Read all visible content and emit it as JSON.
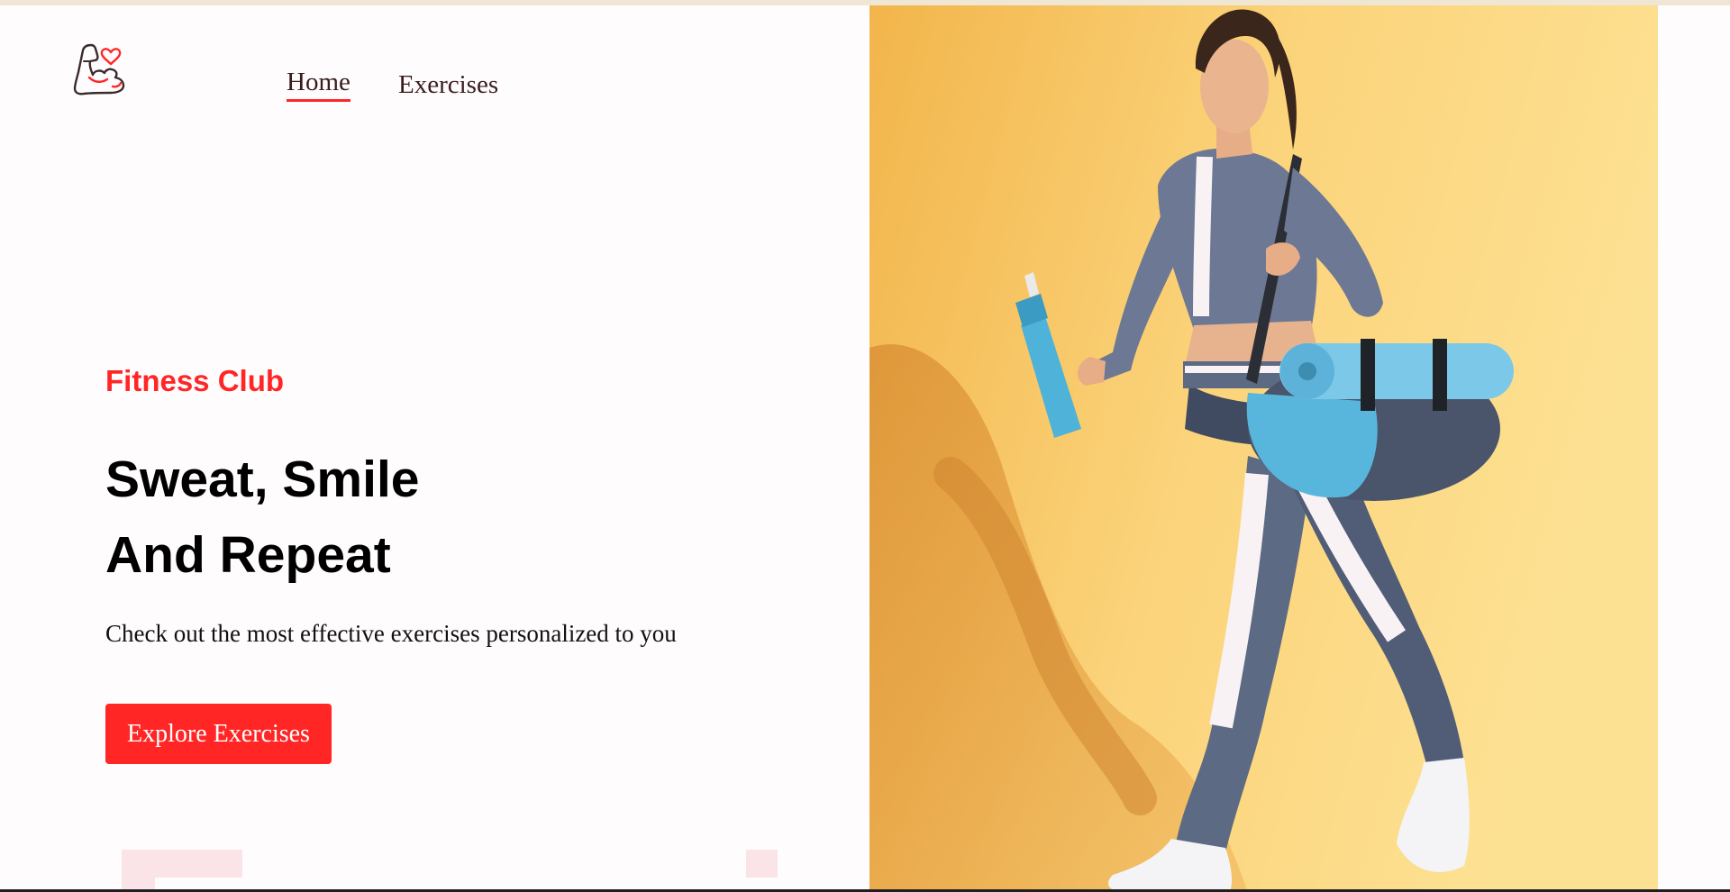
{
  "nav": {
    "logo_icon": "flexed-arm-heart-icon",
    "home_label": "Home",
    "exercises_label": "Exercises"
  },
  "hero": {
    "brand": "Fitness Club",
    "headline_line1": "Sweat, Smile",
    "headline_line2": "And Repeat",
    "subtitle": "Check out the most effective exercises personalized to you",
    "cta_label": "Explore Exercises",
    "image_icon": "woman-walking-with-gym-bag-photo"
  },
  "colors": {
    "accent": "#ff2625",
    "background": "#fffcfd",
    "text_dark": "#3a1d1d",
    "hero_bg": "#f9c95a"
  }
}
